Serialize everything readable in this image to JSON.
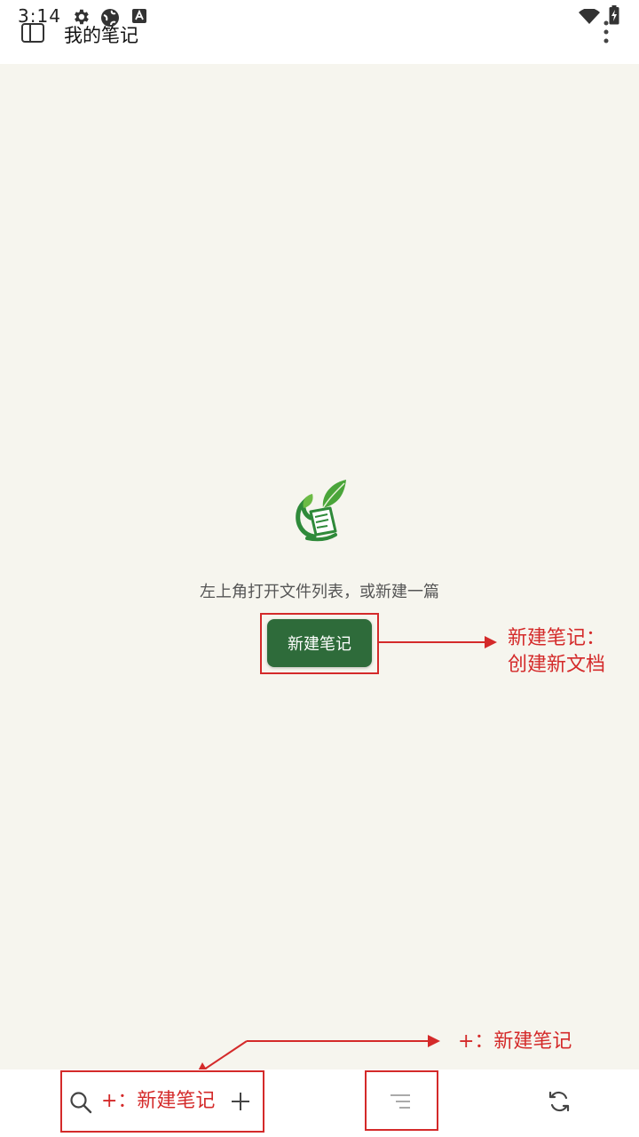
{
  "status_bar": {
    "time": "3:14",
    "icons": [
      "gear-icon",
      "globe-icon",
      "app-notification-icon",
      "wifi-icon",
      "battery-charging-icon"
    ]
  },
  "header": {
    "title": "我的笔记",
    "left_icon": "sidebar-toggle-icon",
    "right_icon": "more-vert-icon"
  },
  "empty_state": {
    "hint": "左上角打开文件列表，或新建一篇",
    "new_note_label": "新建笔记"
  },
  "annotations": {
    "new_note_line1": "新建笔记：",
    "new_note_line2": "创建新文档",
    "plus_top": "+：新建笔记",
    "plus_bottom": "+：新建笔记"
  },
  "bottom_bar": {
    "icons": [
      "search-icon",
      "add-icon",
      "outline-icon",
      "sync-icon"
    ]
  },
  "colors": {
    "accent_green": "#2e6b3a",
    "annotation_red": "#d42a2a",
    "background": "#f6f5ee"
  }
}
